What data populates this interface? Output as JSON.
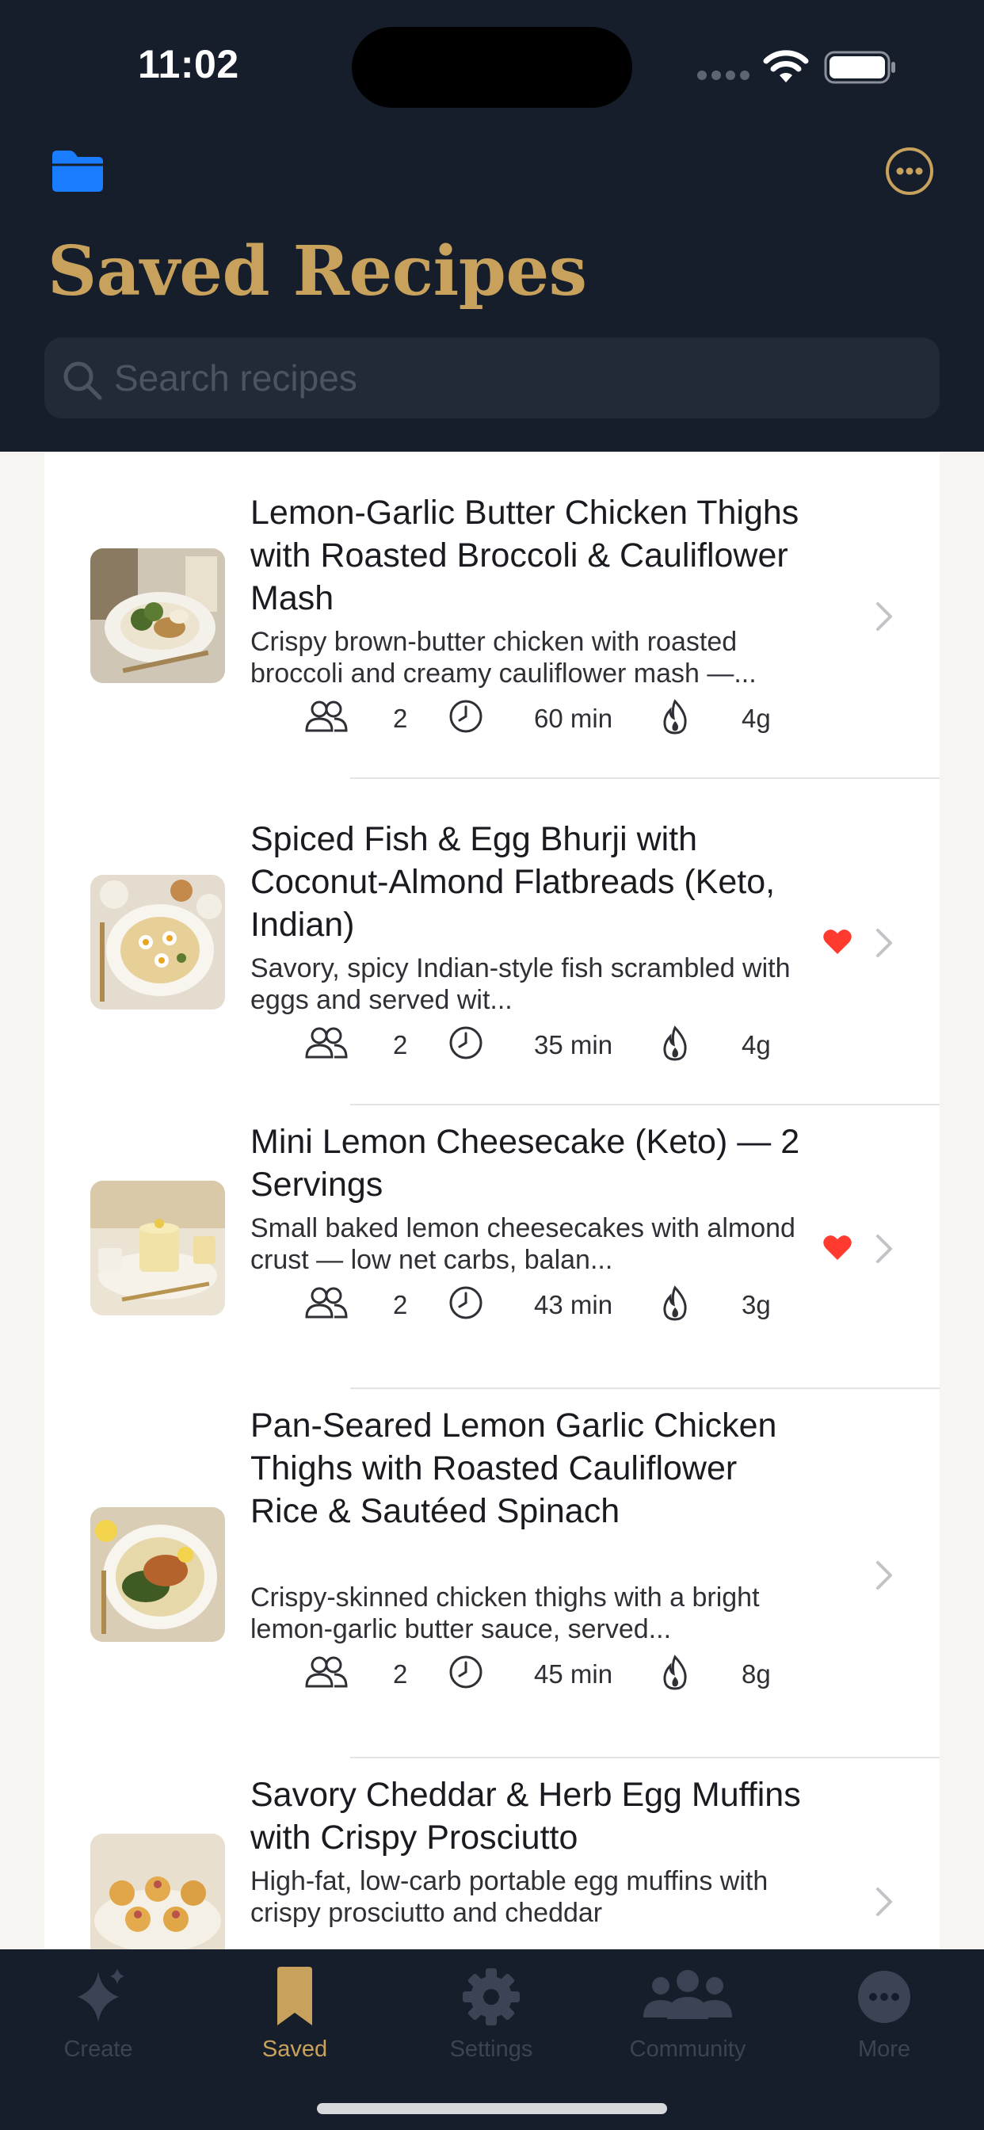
{
  "status_bar": {
    "time": "11:02"
  },
  "header": {
    "title": "Saved Recipes",
    "search_placeholder": "Search recipes",
    "accent": "#c8a25c",
    "background": "#161d2b"
  },
  "recipes": [
    {
      "title": "Lemon-Garlic Butter Chicken Thighs with Roasted Broccoli & Cauliflower Mash",
      "description": "Crispy brown-butter chicken with roasted broccoli and creamy cauliflower mash —...",
      "servings": "2",
      "time": "60 min",
      "net_carbs": "4g",
      "favorite": false
    },
    {
      "title": "Spiced Fish & Egg Bhurji with Coconut-Almond Flatbreads (Keto, Indian)",
      "description": "Savory, spicy Indian-style fish scrambled with eggs and served wit...",
      "servings": "2",
      "time": "35 min",
      "net_carbs": "4g",
      "favorite": true
    },
    {
      "title": "Mini Lemon Cheesecake (Keto) — 2 Servings",
      "description": "Small baked lemon cheesecakes with almond crust — low net carbs, balan...",
      "servings": "2",
      "time": "43 min",
      "net_carbs": "3g",
      "favorite": true
    },
    {
      "title": "Pan-Seared Lemon Garlic Chicken Thighs with Roasted Cauliflower Rice & Sautéed Spinach",
      "description": "Crispy-skinned chicken thighs with a bright lemon-garlic butter sauce, served...",
      "servings": "2",
      "time": "45 min",
      "net_carbs": "8g",
      "favorite": false
    },
    {
      "title": "Savory Cheddar & Herb Egg Muffins with Crispy Prosciutto",
      "description": "High-fat, low-carb portable egg muffins with crispy prosciutto and cheddar",
      "favorite": false
    }
  ],
  "tabs": [
    {
      "label": "Create",
      "icon": "sparkles-icon",
      "active": false
    },
    {
      "label": "Saved",
      "icon": "bookmark-icon",
      "active": true
    },
    {
      "label": "Settings",
      "icon": "gear-icon",
      "active": false
    },
    {
      "label": "Community",
      "icon": "people-icon",
      "active": false
    },
    {
      "label": "More",
      "icon": "ellipsis-circle-icon",
      "active": false
    }
  ],
  "colors": {
    "favorite": "#ff3b30",
    "folder": "#1a7cff",
    "tab_inactive": "#3b4454"
  }
}
